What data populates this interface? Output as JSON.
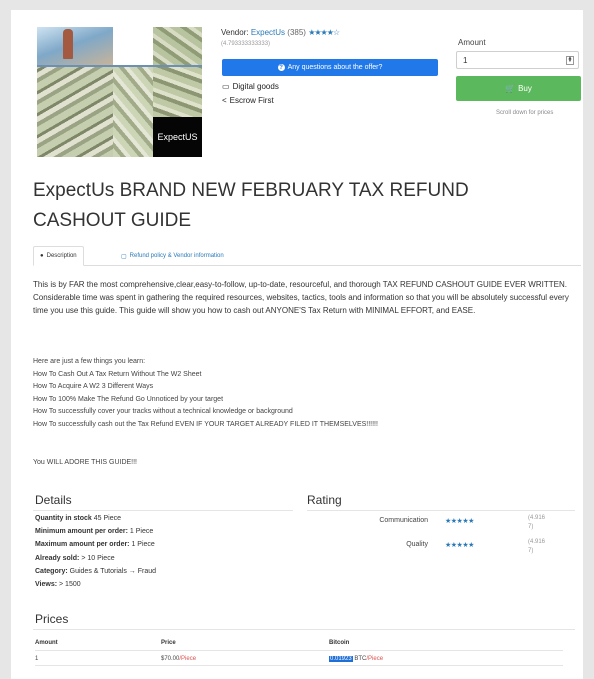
{
  "product_image": {
    "brand_text": "ExpectUS"
  },
  "vendor": {
    "label": "Vendor:",
    "name": "ExpectUs",
    "count": "(385)",
    "stars": "★★★★☆",
    "rating": "(4.793333333333)"
  },
  "question_button": {
    "label": "Any questions about the offer?",
    "icon": "info-icon"
  },
  "features": [
    {
      "icon": "monitor-icon",
      "label": "Digital goods"
    },
    {
      "icon": "share-icon",
      "label": "Escrow First"
    }
  ],
  "order": {
    "amount_label": "Amount",
    "quantity": "1",
    "buy_label": "Buy",
    "scroll_note": "Scroll down for prices"
  },
  "title": "ExpectUs BRAND NEW FEBRUARY TAX REFUND CASHOUT GUIDE",
  "tabs": [
    {
      "label": "Description",
      "icon": "dot-icon",
      "active": true
    },
    {
      "label": "Refund policy & Vendor information",
      "icon": "calendar-icon",
      "active": false
    }
  ],
  "description": "This is by FAR the most comprehensive,clear,easy-to-follow, up-to-date, resourceful, and thorough TAX REFUND CASHOUT GUIDE EVER WRITTEN. Considerable time was spent in gathering the required resources, websites, tactics, tools and information so that you will be absolutely successful every time you use this guide. This guide will show you how to cash out ANYONE'S Tax Return with MINIMAL EFFORT, and EASE.",
  "learn_list": [
    "Here are just a few things you learn:",
    "How To Cash Out A Tax Return Without The W2 Sheet",
    "How To Acquire A W2 3 Different Ways",
    "How To 100% Make The Refund Go Unnoticed by your target",
    "How To successfully cover your tracks without a technical knowledge or background",
    "How To successfully cash out the Tax Refund EVEN IF YOUR TARGET ALREADY FILED IT THEMSELVES!!!!!!"
  ],
  "closing": "You WILL ADORE THIS GUIDE!!!",
  "details": {
    "heading": "Details",
    "rows": [
      {
        "label": "Quantity in stock",
        "value": "45 Piece"
      },
      {
        "label": "Minimum amount per order:",
        "value": "1 Piece"
      },
      {
        "label": "Maximum amount per order:",
        "value": "1 Piece"
      },
      {
        "label": "Already sold:",
        "value": "> 10 Piece"
      },
      {
        "label": "Category:",
        "value": "Guides & Tutorials → Fraud"
      },
      {
        "label": "Views:",
        "value": "> 1500"
      }
    ]
  },
  "rating": {
    "heading": "Rating",
    "rows": [
      {
        "label": "Communication",
        "stars": "★★★★★",
        "value": "(4.916 7)"
      },
      {
        "label": "Quality",
        "stars": "★★★★★",
        "value": "(4.916 7)"
      }
    ]
  },
  "prices": {
    "heading": "Prices",
    "columns": [
      "Amount",
      "Price",
      "Bitcoin"
    ],
    "rows": [
      {
        "amount": "1",
        "price": "$70.00",
        "price_unit": "/Piece",
        "btc": "0.01923",
        "btc_unit": "BTC",
        "btc_piece": "/Piece"
      }
    ]
  }
}
